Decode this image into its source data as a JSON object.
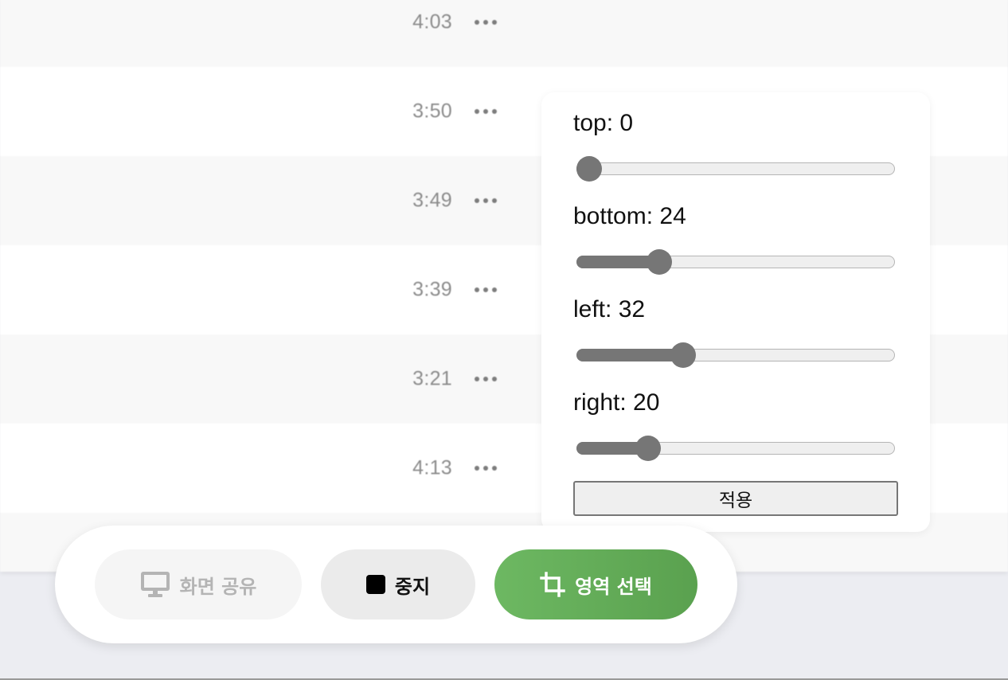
{
  "tracks": [
    {
      "duration": "4:03"
    },
    {
      "duration": "3:50"
    },
    {
      "duration": "3:49"
    },
    {
      "duration": "3:39"
    },
    {
      "duration": "3:21"
    },
    {
      "duration": "4:13"
    },
    {
      "duration": ""
    }
  ],
  "crop_panel": {
    "top": {
      "label": "top: 0",
      "value": 0,
      "max": 100
    },
    "bottom": {
      "label": "bottom: 24",
      "value": 24,
      "max": 100
    },
    "left": {
      "label": "left: 32",
      "value": 32,
      "max": 100
    },
    "right": {
      "label": "right: 20",
      "value": 20,
      "max": 100
    },
    "apply_label": "적용"
  },
  "toolbar": {
    "share_label": "화면 공유",
    "stop_label": "중지",
    "region_label": "영역 선택",
    "accent_color": "#62ad57",
    "icons": {
      "share": "monitor-icon",
      "stop": "stop-icon",
      "region": "crop-icon"
    }
  }
}
